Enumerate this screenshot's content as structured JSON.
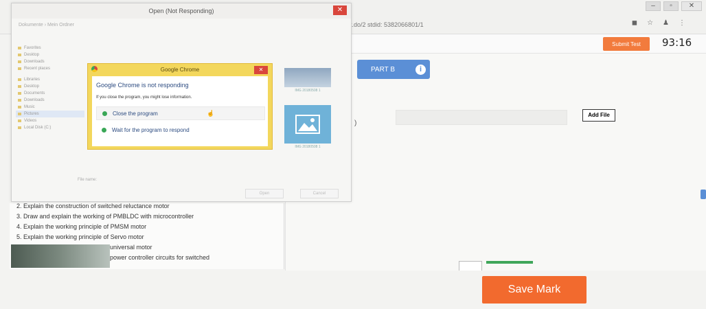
{
  "browser": {
    "minimize": "–",
    "maximize": "▫",
    "close": "✕",
    "address": "t.do/2 stdid: 5382066801/1"
  },
  "header": {
    "submit_label": "Submit Test",
    "timer": "93:16"
  },
  "main": {
    "part_label": "PART B",
    "info_icon": "i",
    "paren": ")",
    "add_file_label": "Add File"
  },
  "document": {
    "lines": [
      "2. Explain the construction of switched reluctance motor",
      "3. Draw and explain the working of PMBLDC with microcontroller",
      "4. Explain the working principle of PMSM motor",
      "5. Explain the working principle of Servo motor",
      "universal motor",
      "power controller circuits for switched"
    ]
  },
  "open_dialog": {
    "title": "Open (Not Responding)",
    "close": "✕",
    "nav_text": "Dokumente  ›  Mein Ordner",
    "tree_items": [
      "Favorites",
      "Desktop",
      "Downloads",
      "Recent places",
      "Libraries",
      "Desktop",
      "Documents",
      "Downloads",
      "Music",
      "Pictures",
      "Videos",
      "Local Disk (C:)"
    ],
    "thumb_caption_1": "IMG 20180508 1",
    "thumb_caption_2": "IMG 20180508 1",
    "filename_label": "File name:",
    "open_label": "Open",
    "cancel_label": "Cancel"
  },
  "chrome_dialog": {
    "title": "Google Chrome",
    "close": "✕",
    "heading": "Google Chrome is not responding",
    "subtext": "If you close the program, you might lose information.",
    "option_close": "Close the program",
    "option_wait": "Wait for the program to respond"
  },
  "footer": {
    "save_mark_label": "Save Mark"
  }
}
